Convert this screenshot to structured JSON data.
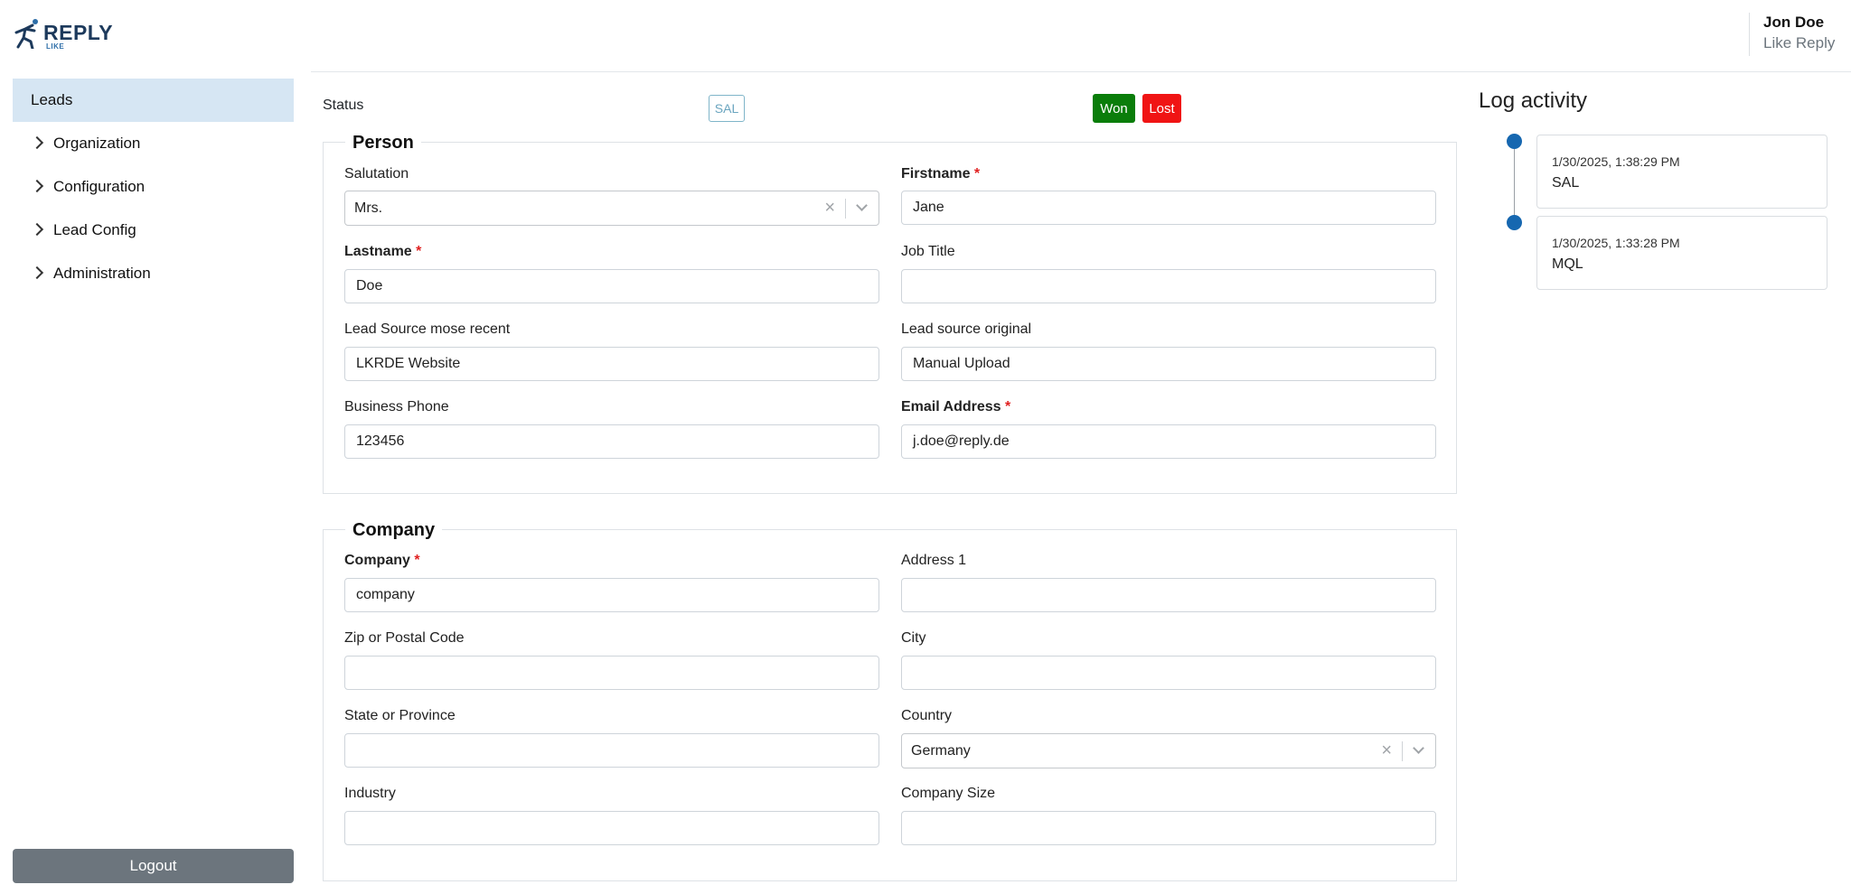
{
  "brand": {
    "name": "REPLY",
    "sub": "LIKE"
  },
  "user": {
    "name": "Jon Doe",
    "org": "Like Reply"
  },
  "sidebar": {
    "items": [
      {
        "label": "Leads"
      },
      {
        "label": "Organization"
      },
      {
        "label": "Configuration"
      },
      {
        "label": "Lead Config"
      },
      {
        "label": "Administration"
      }
    ],
    "logout_label": "Logout"
  },
  "status": {
    "label": "Status",
    "current": "SAL",
    "won_label": "Won",
    "lost_label": "Lost",
    "colors": {
      "won": "#0a7d0a",
      "lost": "#f01414"
    }
  },
  "person": {
    "legend": "Person",
    "salutation": {
      "label": "Salutation",
      "value": "Mrs."
    },
    "firstname": {
      "label": "Firstname",
      "value": "Jane"
    },
    "lastname": {
      "label": "Lastname",
      "value": "Doe"
    },
    "job_title": {
      "label": "Job Title",
      "value": ""
    },
    "lead_source_recent": {
      "label": "Lead Source mose recent",
      "value": "LKRDE Website"
    },
    "lead_source_original": {
      "label": "Lead source original",
      "value": "Manual Upload"
    },
    "business_phone": {
      "label": "Business Phone",
      "value": "123456"
    },
    "email": {
      "label": "Email Address",
      "value": "j.doe@reply.de"
    }
  },
  "company": {
    "legend": "Company",
    "company": {
      "label": "Company",
      "value": "company"
    },
    "address1": {
      "label": "Address 1",
      "value": ""
    },
    "zip": {
      "label": "Zip or Postal Code",
      "value": ""
    },
    "city": {
      "label": "City",
      "value": ""
    },
    "state": {
      "label": "State or Province",
      "value": ""
    },
    "country": {
      "label": "Country",
      "value": "Germany"
    },
    "industry": {
      "label": "Industry",
      "value": ""
    },
    "company_size": {
      "label": "Company Size",
      "value": ""
    }
  },
  "required_marker": "*",
  "icons": {
    "clear": "×"
  },
  "log": {
    "title": "Log activity",
    "entries": [
      {
        "date": "1/30/2025, 1:38:29 PM",
        "status": "SAL"
      },
      {
        "date": "1/30/2025, 1:33:28 PM",
        "status": "MQL"
      }
    ]
  }
}
